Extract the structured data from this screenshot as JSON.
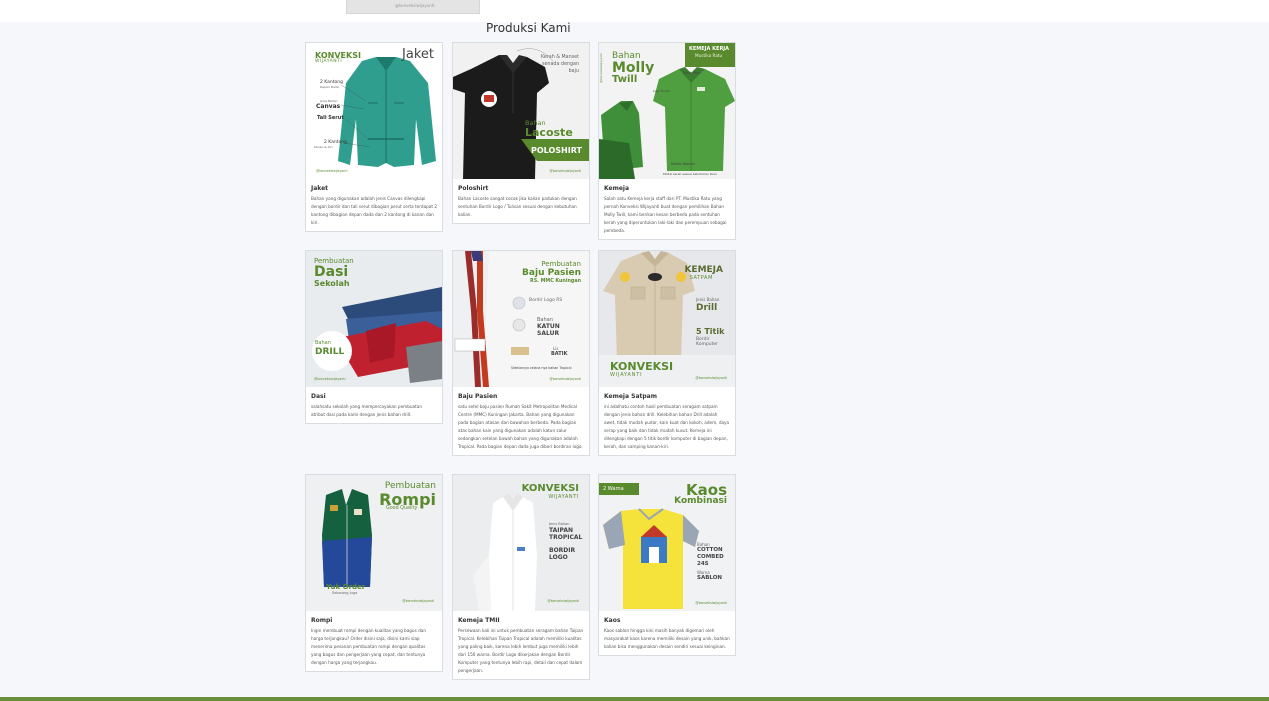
{
  "top_thumb_caption": "@konveksiwijayanti",
  "section_title": "Produksi Kami",
  "products": [
    {
      "name": "Jaket",
      "desc": "Bahan yang digunakan adalah jenis Canvas dilengkapi dengan bordir dan tali serut dibagian perut serta terdapat 2 kantong dibagian depan dada dan 2 kantong di kanan dan kiri.",
      "img": {
        "brand1": "KONVEKSI",
        "brand2": "WIJAYANTI",
        "title": "Jaket",
        "label1": "2 Kantong",
        "label1b": "Depan Dada",
        "label2": "Jenis Bahan",
        "label2b": "Canvas",
        "label3": "Tali Serut",
        "label4": "2 Kantong",
        "label4b": "Kanan & Kiri",
        "handle": "@konveksiwijayanti"
      }
    },
    {
      "name": "Poloshirt",
      "desc": "Bahan Lacoste sangat cocok jika kalian padukan dengan sentuhan Bordir Logo / Tulisan sesuai dengan kebutuhan kalian.",
      "img": {
        "note1": "Kerah & Manset",
        "note2": "senada dengan",
        "note3": "baju",
        "label": "Bahan",
        "material": "Lacoste",
        "banner": "POLOSHIRT",
        "handle": "@konveksiwijayanti"
      }
    },
    {
      "name": "Kemeja",
      "desc": "Salah satu Kemeja kerja staff dari PT. Mustika Ratu yang pernah Konveksi Wijayanti buat dengan pemilihan Bahan Molly Twill, kami berikan kesan berbeda pada sentuhan kerah yang diperuntukan laki-laki dan perempuan sebagai pembeda.",
      "img": {
        "handle_v": "@konveksiwijayanti",
        "label": "Bahan",
        "material1": "Molly",
        "material2": "Twill",
        "badge1": "KEMEJA KERJA",
        "badge2": "Mustika Ratu",
        "note_collar": "Kerah Polo",
        "note_logo": "Logo Bordir",
        "note_model": "Model Wanita",
        "note_bottom": "Model kerah sesuai kebutuhan klien"
      }
    },
    {
      "name": "Dasi",
      "desc": "salahsatu sekolah yang mempercayakan pembuatan atribut dasi pada kami dengan jenis bahan drill.",
      "img": {
        "title1": "Pembuatan",
        "title2": "Dasi",
        "title3": "Sekolah",
        "label": "Bahan",
        "material": "DRILL",
        "handle": "@konveksiwijayanti"
      }
    },
    {
      "name": "Baju Pasien",
      "desc": "satu setel baju pasien Rumah Sakit Metropolitan Medical Centre (MMC) Kuningan Jakarta. Bahan yang digunakan pada bagian atasan dan bawahan berbeda. Pada bagian atas bahan kain yang digunakan adalah katun salur sedangkan setelan bawah bahan yang digunakan adalah Tropical. Pada bagian depan dada juga diberi bordiran logo.",
      "img": {
        "title1": "Pembuatan",
        "title2": "Baju Pasien",
        "title3": "RS. MMC Kuningan",
        "label1": "Bordir Logo RS",
        "label2a": "Bahan",
        "label2b": "KATUN",
        "label2c": "SALUR",
        "label3a": "Lis",
        "label3b": "BATIK",
        "note": "Setelannya celana nya bahan Tropical",
        "handle": "@konveksiwijayanti"
      }
    },
    {
      "name": "Kemeja Satpam",
      "desc": "ini adalhatu contoh hasil pembuatan seragam satpam dengan jenis bahan drill. Kelebihan bahan Drill adalah awet, tidak mudah pudar, kain kuat dan kokoh, adem, daya serap yang baik dan tidak mudah kusut. Kemeja ini dilengkapi dengan 5 titik bordir komputer di bagian depan, kerah, dan samping kanan-kiri.",
      "img": {
        "title1": "KEMEJA",
        "title2": "SATPAM",
        "label1a": "Jenis Bahan",
        "label1b": "Drill",
        "label2a": "5 Titik",
        "label2b": "Bordir",
        "label2c": "Komputer",
        "brand1": "KONVEKSI",
        "brand2": "WIJAYANTI",
        "handle": "@konveksiwijayanti"
      }
    },
    {
      "name": "Rompi",
      "desc": "Ingin membuat rompi dengan kualitas yang bagus dan harga terjangkau? Order disini saja, disini kami siap menerima pesanan pembuatan rompi dengan qualitas yang bagus dan pengerjaan yang cepat, dan tentunya dengan harga yang terjangkau.",
      "img": {
        "title1": "Pembuatan",
        "title2": "Rompi",
        "title3": "Good Quality",
        "cta1": "Yuk Order",
        "cta2": "Sekarang Juga",
        "handle": "@konveksiwijayanti"
      }
    },
    {
      "name": "Kemeja TMII",
      "desc": "Persewaan kali ini untuk pembuatan seragam bahan Taipan Tropical. Kelebihan Taipan Tropical adalah memiliki kualitas yang paling baik, karena lebih lembut juga memiliki lebih dari 150 warna. Bordir Logo dikerjakan dengan Bordir Komputer yang tentunya lebih rapi, detail dan cepat dalam pengerjaan.",
      "img": {
        "brand1": "KONVEKSI",
        "brand2": "WIJAYANTI",
        "label1a": "Jenis Bahan",
        "label1b": "TAIPAN",
        "label1c": "TROPICAL",
        "label2a": "BORDIR",
        "label2b": "LOGO",
        "handle": "@konveksiwijayanti"
      }
    },
    {
      "name": "Kaos",
      "desc": "Kaos sablon hingga kini masih banyak digemari oleh masyarakat kaos karena memiliki desain yang unik, bahkan kalian bisa menggunakan desain sendiri sesuai keinginan.",
      "img": {
        "badge": "2 Warna",
        "title1": "Kaos",
        "title2": "Kombinasi",
        "label1a": "Bahan",
        "label1b": "COTTON",
        "label1c": "COMBED",
        "label1d": "24S",
        "label2a": "Warna",
        "label2b": "SABLON",
        "handle": "@konveksiwijayanti"
      }
    }
  ]
}
